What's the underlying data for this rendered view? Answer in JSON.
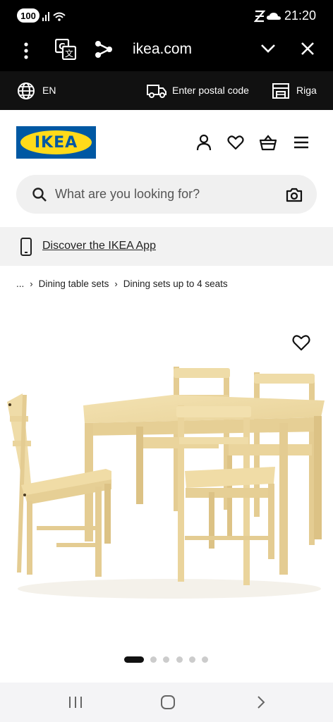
{
  "status_bar": {
    "battery": "100",
    "time": "21:20"
  },
  "browser": {
    "url": "ikea.com"
  },
  "utility_bar": {
    "language": "EN",
    "postal_code_label": "Enter postal code",
    "store": "Riga"
  },
  "header": {
    "logo_text": "IKEA"
  },
  "search": {
    "placeholder": "What are you looking for?"
  },
  "app_banner": {
    "link_text": "Discover the IKEA App"
  },
  "breadcrumb": {
    "ellipsis": "...",
    "items": [
      "Dining table sets",
      "Dining sets up to 4 seats"
    ]
  },
  "gallery": {
    "total_images": 6,
    "active_index": 0
  },
  "colors": {
    "ikea_blue": "#0058a3",
    "ikea_yellow": "#ffda1a",
    "pine": "#f0dca6"
  }
}
